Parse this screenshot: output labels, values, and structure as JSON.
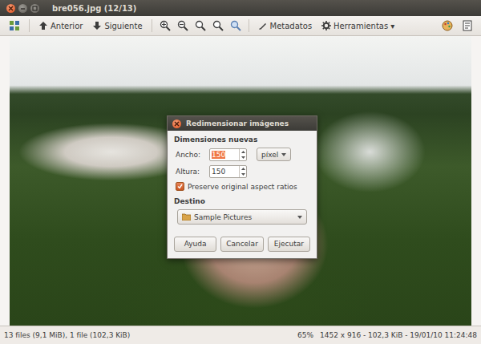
{
  "window": {
    "title": "bre056.jpg (12/13)"
  },
  "toolbar": {
    "items": [
      {
        "label": "Anterior"
      },
      {
        "label": "Siguiente"
      },
      {
        "label": "Metadatos"
      },
      {
        "label": "Herramientas"
      }
    ],
    "menu_arrow": "▾"
  },
  "dialog": {
    "title": "Redimensionar imágenes",
    "size_section": "Dimensiones nuevas",
    "width": {
      "label": "Ancho:",
      "value": "150",
      "text_selected": true
    },
    "unit": "píxel",
    "height": {
      "label": "Altura:",
      "value": "150"
    },
    "preserve": {
      "label": "Preserve original aspect ratios",
      "checked": true
    },
    "destination_section": "Destino",
    "destination": "Sample Pictures",
    "buttons": [
      "Ayuda",
      "Cancelar",
      "Ejecutar"
    ]
  },
  "status_bar": {
    "left": "13 files (9,1 MiB), 1 file (102,3 KiB)",
    "zoom": "65%",
    "info": "1452 x 916 - 102,3 KiB - 19/01/10 11:24:48"
  }
}
